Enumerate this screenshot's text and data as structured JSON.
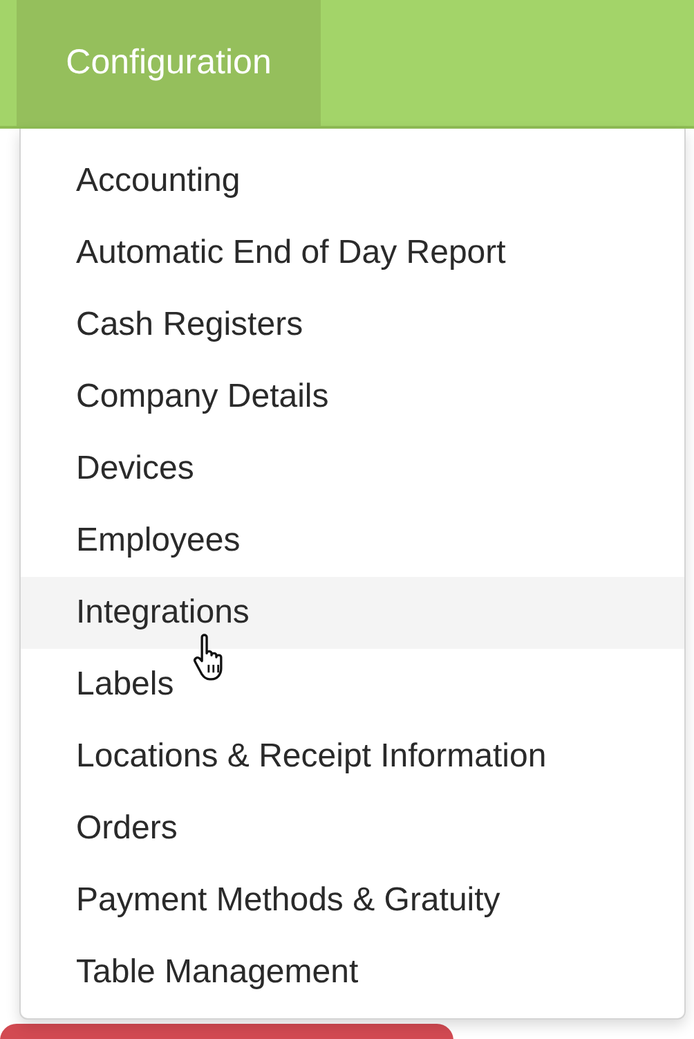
{
  "nav": {
    "tabs": [
      {
        "label": "Configuration",
        "selected": true
      }
    ]
  },
  "menu": {
    "items": [
      {
        "label": "Accounting",
        "hovered": false
      },
      {
        "label": "Automatic End of Day Report",
        "hovered": false
      },
      {
        "label": "Cash Registers",
        "hovered": false
      },
      {
        "label": "Company Details",
        "hovered": false
      },
      {
        "label": "Devices",
        "hovered": false
      },
      {
        "label": "Employees",
        "hovered": false
      },
      {
        "label": "Integrations",
        "hovered": true
      },
      {
        "label": "Labels",
        "hovered": false
      },
      {
        "label": "Locations & Receipt Information",
        "hovered": false
      },
      {
        "label": "Orders",
        "hovered": false
      },
      {
        "label": "Payment Methods & Gratuity",
        "hovered": false
      },
      {
        "label": "Table Management",
        "hovered": false
      }
    ]
  }
}
